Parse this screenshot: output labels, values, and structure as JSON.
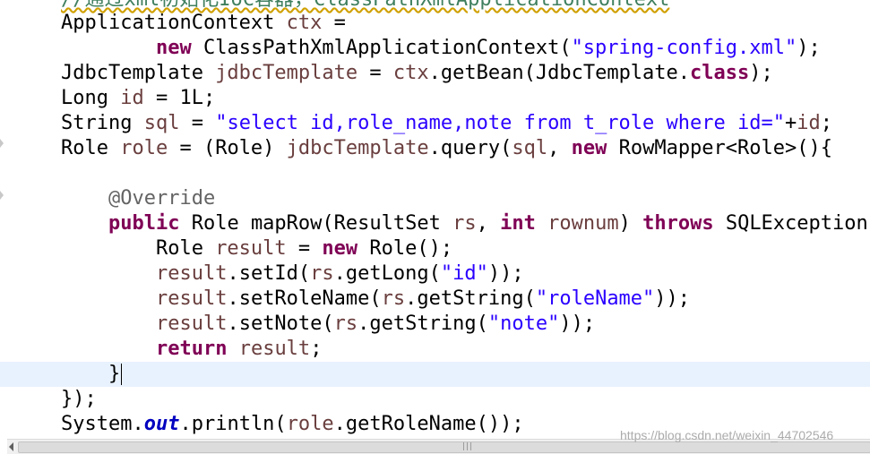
{
  "editor": {
    "top_partial_line": "//通过xml初始化IoC容器，ClassPathXmlApplicationContext",
    "lines": {
      "l1": {
        "t1": "ApplicationContext ",
        "t2": "ctx",
        "t3": " ="
      },
      "l2": {
        "t1": "        ",
        "t2": "new",
        "t3": " ClassPathXmlApplicationContext(",
        "t4": "\"spring-config.xml\"",
        "t5": ");"
      },
      "l3": {
        "t1": "JdbcTemplate ",
        "t2": "jdbcTemplate",
        "t3": " = ",
        "t4": "ctx",
        "t5": ".getBean(JdbcTemplate.",
        "t6": "class",
        "t7": ");"
      },
      "l4": {
        "t1": "Long ",
        "t2": "id",
        "t3": " = 1L;"
      },
      "l5": {
        "t1": "String ",
        "t2": "sql",
        "t3": " = ",
        "t4": "\"select id,role_name,note from t_role where id=\"",
        "t5": "+",
        "t6": "id",
        "t7": ";"
      },
      "l6": {
        "t1": "Role ",
        "t2": "role",
        "t3": " = (Role) ",
        "t4": "jdbcTemplate",
        "t5": ".query(",
        "t6": "sql",
        "t7": ", ",
        "t8": "new",
        "t9": " RowMapper<Role>(){"
      },
      "l8": {
        "t1": "    ",
        "t2": "@Override"
      },
      "l9": {
        "t1": "    ",
        "t2": "public",
        "t3": " Role mapRow(ResultSet ",
        "t4": "rs",
        "t5": ", ",
        "t6": "int",
        "t7": " ",
        "t8": "rownum",
        "t9": ") ",
        "t10": "throws",
        "t11": " SQLException {"
      },
      "l10": {
        "t1": "        Role ",
        "t2": "result",
        "t3": " = ",
        "t4": "new",
        "t5": " Role();"
      },
      "l11": {
        "t1": "        ",
        "t2": "result",
        "t3": ".setId(",
        "t4": "rs",
        "t5": ".getLong(",
        "t6": "\"id\"",
        "t7": "));"
      },
      "l12": {
        "t1": "        ",
        "t2": "result",
        "t3": ".setRoleName(",
        "t4": "rs",
        "t5": ".getString(",
        "t6": "\"roleName\"",
        "t7": "));"
      },
      "l13": {
        "t1": "        ",
        "t2": "result",
        "t3": ".setNote(",
        "t4": "rs",
        "t5": ".getString(",
        "t6": "\"note\"",
        "t7": "));"
      },
      "l14": {
        "t1": "        ",
        "t2": "return",
        "t3": " ",
        "t4": "result",
        "t5": ";"
      },
      "l15": {
        "t1": "    }"
      },
      "l16": {
        "t1": "});"
      },
      "l17": {
        "t1": "System.",
        "t2": "out",
        "t3": ".println(",
        "t4": "role",
        "t5": ".getRoleName());"
      }
    }
  },
  "scrollbar": {
    "grip": "|||"
  },
  "watermark": "https://blog.csdn.net/weixin_44702546",
  "colors": {
    "keyword": "#7f0055",
    "string": "#2a00ff",
    "local_variable": "#6a3e3e",
    "annotation": "#646464",
    "static_field": "#0000c0",
    "current_line": "#e8f2fe"
  }
}
